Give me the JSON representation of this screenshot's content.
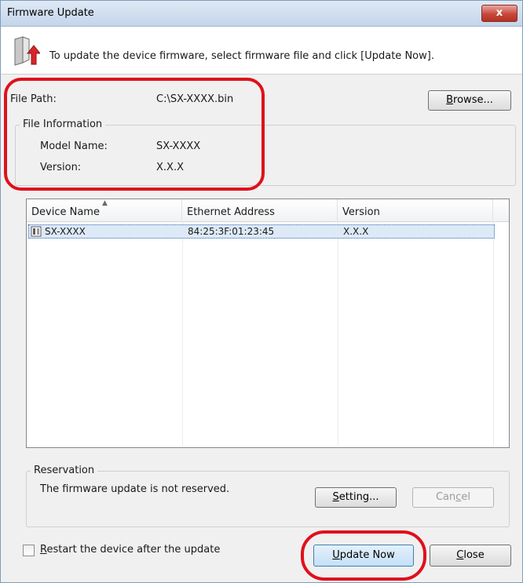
{
  "window": {
    "title": "Firmware Update",
    "close_glyph": "x"
  },
  "header": {
    "instruction": "To update the device firmware, select firmware file and click [Update Now]."
  },
  "file": {
    "path_label": "File Path:",
    "path_value": "C:\\SX-XXXX.bin",
    "browse_label": "rowse...",
    "browse_mnemonic": "B",
    "info_caption": "File Information",
    "model_label": "Model Name:",
    "model_value": "SX-XXXX",
    "version_label": "Version:",
    "version_value": "X.X.X"
  },
  "devices": {
    "columns": [
      "Device Name",
      "Ethernet Address",
      "Version"
    ],
    "rows": [
      {
        "name": "SX-XXXX",
        "ethernet": "84:25:3F:01:23:45",
        "version": "X.X.X"
      }
    ]
  },
  "reservation": {
    "caption": "Reservation",
    "status": "The firmware update is not reserved.",
    "setting_mnemonic": "S",
    "setting_label": "etting...",
    "cancel_pre": "Can",
    "cancel_mnemonic": "c",
    "cancel_post": "el"
  },
  "footer": {
    "restart_mnemonic": "R",
    "restart_label": "estart the device after the update",
    "update_mnemonic": "U",
    "update_label": "pdate Now",
    "close_mnemonic": "C",
    "close_label": "lose"
  },
  "colors": {
    "highlight_ring": "#e0101c",
    "title_bar": "#c4d5ea",
    "selection": "#dde9f7"
  }
}
